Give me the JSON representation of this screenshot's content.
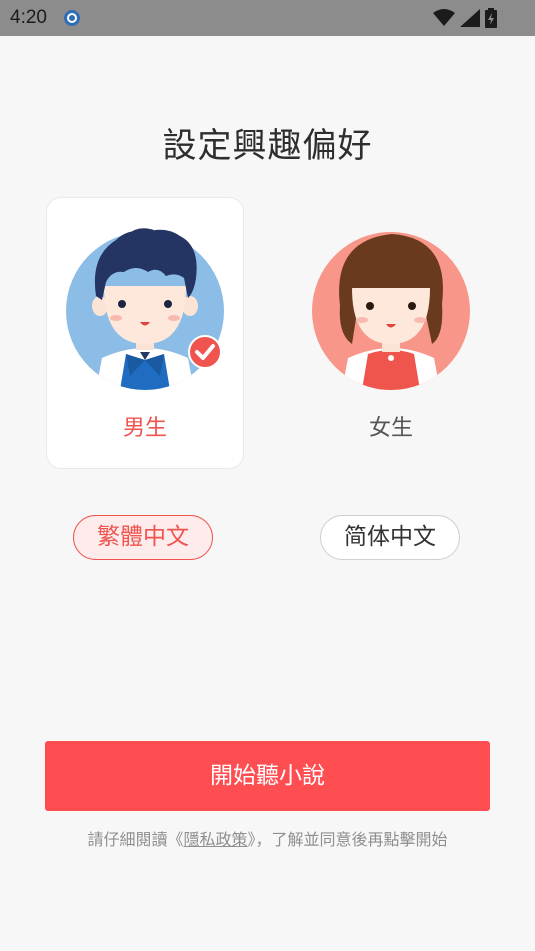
{
  "status_bar": {
    "time": "4:20",
    "icons": [
      "app-notification-icon",
      "wifi-icon",
      "cell-signal-icon",
      "battery-charging-icon"
    ]
  },
  "title": "設定興趣偏好",
  "gender_options": {
    "male": {
      "label": "男生",
      "selected": true,
      "label_color": "#f0544f",
      "avatar_bg": "#8cbde6"
    },
    "female": {
      "label": "女生",
      "selected": false,
      "label_color": "#555555",
      "avatar_bg": "#f8968a"
    }
  },
  "language_options": {
    "traditional": {
      "label": "繁體中文",
      "selected": true
    },
    "simplified": {
      "label": "简体中文",
      "selected": false
    }
  },
  "start_button": {
    "label": "開始聽小說"
  },
  "agreement": {
    "prefix": "請仔細閱讀《",
    "link": "隱私政策",
    "suffix": "》，了解並同意後再點擊開始"
  },
  "colors": {
    "accent": "#fe4e52",
    "selected_text": "#f0544f",
    "status_bar": "#8c8c8c",
    "background": "#f7f7f7"
  }
}
